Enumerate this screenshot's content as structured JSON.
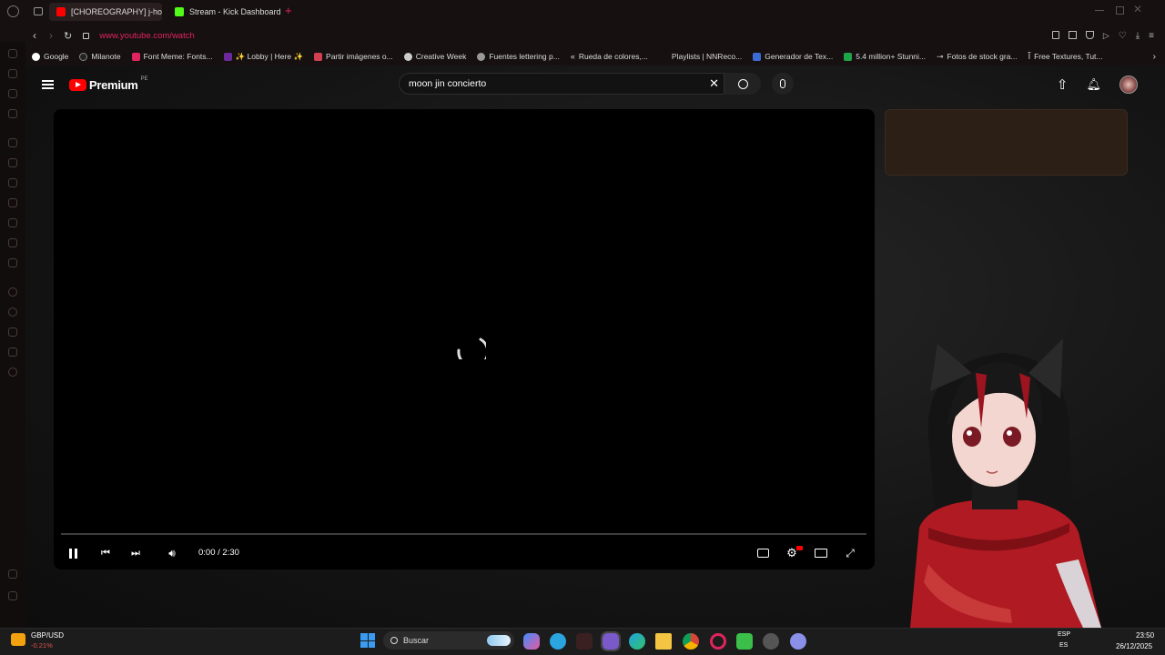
{
  "browser": {
    "tabs": [
      {
        "label": "[CHOREOGRAPHY] j-hop...",
        "active": true,
        "icon": "youtube-favicon"
      },
      {
        "label": "Stream - Kick Dashboard",
        "active": false,
        "icon": "kick-favicon"
      }
    ],
    "new_tab_label": "+",
    "url": "www.youtube.com/watch",
    "bookmarks": [
      "Google",
      "Milanote",
      "Font Meme: Fonts...",
      "✨ Lobby | Here ✨",
      "Partir imágenes o...",
      "Creative Week",
      "Fuentes lettering p...",
      "Rueda de colores,...",
      "Playlists | NNReco...",
      "Generador de Tex...",
      "5.4 million+ Stunni...",
      "Fotos de stock gra...",
      "Free Textures, Tut..."
    ]
  },
  "youtube": {
    "brand": "Premium",
    "region": "PE",
    "search": {
      "value": "moon jin concierto"
    },
    "player": {
      "time": "0:00 / 2:30",
      "progress": 0.0
    }
  },
  "taskbar": {
    "widget_title": "GBP/USD",
    "widget_value": "-0.21%",
    "search_label": "Buscar",
    "lang_top": "ESP",
    "lang_bottom": "ES",
    "time": "23:50",
    "date": "26/12/2025"
  },
  "colors": {
    "youtube_red": "#ff0000",
    "kick_green": "#53fc18",
    "accent_pink": "#e0245e"
  }
}
